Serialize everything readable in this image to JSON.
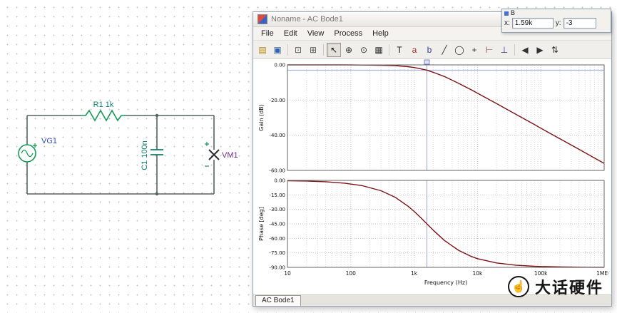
{
  "window": {
    "title": "Noname - AC Bode1",
    "menu": [
      "File",
      "Edit",
      "View",
      "Process",
      "Help"
    ],
    "tab": "AC Bode1",
    "toolbar": [
      {
        "name": "open-file",
        "glyph": "▤",
        "color": "#b8860b"
      },
      {
        "name": "save-file",
        "glyph": "▣",
        "color": "#2f5fae"
      },
      {
        "sep": true
      },
      {
        "name": "copy",
        "glyph": "⊡",
        "color": "#555555"
      },
      {
        "name": "paste",
        "glyph": "⊞",
        "color": "#555555"
      },
      {
        "sep": true
      },
      {
        "name": "select-cursor",
        "glyph": "↖",
        "color": "#111111",
        "pressed": true
      },
      {
        "name": "zoom-in",
        "glyph": "⊕",
        "color": "#333333"
      },
      {
        "name": "zoom-window",
        "glyph": "⊙",
        "color": "#333333"
      },
      {
        "name": "grid-toggle",
        "glyph": "▦",
        "color": "#333333"
      },
      {
        "sep": true
      },
      {
        "name": "text-tool",
        "glyph": "T",
        "color": "#111111"
      },
      {
        "name": "cursor-a-tool",
        "glyph": "a",
        "color": "#a03030"
      },
      {
        "name": "cursor-b-tool",
        "glyph": "b",
        "color": "#3040a0"
      },
      {
        "name": "line-tool",
        "glyph": "╱",
        "color": "#333333"
      },
      {
        "name": "ellipse-tool",
        "glyph": "◯",
        "color": "#333333"
      },
      {
        "name": "cross-tool",
        "glyph": "+",
        "color": "#333333"
      },
      {
        "name": "axis-x-tool",
        "glyph": "⊢",
        "color": "#883333"
      },
      {
        "name": "axis-y-tool",
        "glyph": "⊥",
        "color": "#333388"
      },
      {
        "sep": true
      },
      {
        "name": "prev-curve",
        "glyph": "◀",
        "color": "#333333"
      },
      {
        "name": "next-curve",
        "glyph": "▶",
        "color": "#333333"
      },
      {
        "name": "spin-control",
        "glyph": "⇅",
        "color": "#333333"
      }
    ]
  },
  "cursor_panel": {
    "title": "B",
    "x_label": "x:",
    "x_value": "1.59k",
    "y_label": "y:",
    "y_value": "-3"
  },
  "schematic": {
    "labels": {
      "source": "VG1",
      "resistor": "R1 1k",
      "capacitor": "C1 100n",
      "meter": "VM1"
    },
    "colors": {
      "wire": "#52655c",
      "component": "#149a55",
      "capacitor": "#0f7d6c",
      "value_label": "#0c7f6f",
      "source_label": "#2f49b0",
      "meter_label": "#6a2a8a"
    }
  },
  "watermark": {
    "icon_glyph": "☝",
    "text": "大话硬件"
  },
  "chart_data": [
    {
      "name": "gain-bode-plot",
      "type": "line",
      "title": "",
      "xlabel": "Frequency (Hz)",
      "ylabel": "Gain (dB)",
      "xscale": "log",
      "xlim": [
        10,
        1000000
      ],
      "ylim": [
        -60,
        0
      ],
      "yticks": [
        0,
        -20,
        -40,
        -60
      ],
      "ytick_labels": [
        "0.00",
        "-20.00",
        "-40.00",
        "-60.00"
      ],
      "xticks": [
        10,
        100,
        1000,
        10000,
        100000,
        1000000
      ],
      "xtick_labels": [
        "10",
        "100",
        "1k",
        "10k",
        "100k",
        "1MEG"
      ],
      "show_x_labels": false,
      "grid": true,
      "cursor": {
        "x": 1590,
        "y": -3,
        "label": "B",
        "color": "#96a3dd"
      },
      "series": [
        {
          "name": "gain",
          "color": "#7d1316",
          "x": [
            10,
            20,
            40,
            80,
            150,
            300,
            500,
            800,
            1000,
            1300,
            1590,
            2000,
            3000,
            5000,
            8000,
            10000,
            20000,
            40000,
            80000,
            100000,
            200000,
            400000,
            700000,
            1000000
          ],
          "y": [
            0,
            0,
            0,
            0,
            -0.1,
            -0.2,
            -0.4,
            -1.0,
            -1.5,
            -2.3,
            -3.0,
            -4.2,
            -6.6,
            -10.4,
            -14.2,
            -16.1,
            -22.0,
            -28.0,
            -34.0,
            -36.0,
            -42.0,
            -48.0,
            -52.9,
            -56.0
          ]
        }
      ]
    },
    {
      "name": "phase-bode-plot",
      "type": "line",
      "title": "",
      "xlabel": "Frequency (Hz)",
      "ylabel": "Phase [deg]",
      "xscale": "log",
      "xlim": [
        10,
        1000000
      ],
      "ylim": [
        -90,
        0
      ],
      "yticks": [
        0,
        -15,
        -30,
        -45,
        -60,
        -75,
        -90
      ],
      "ytick_labels": [
        "0.00",
        "-15.00",
        "-30.00",
        "-45.00",
        "-60.00",
        "-75.00",
        "-90.00"
      ],
      "xticks": [
        10,
        100,
        1000,
        10000,
        100000,
        1000000
      ],
      "xtick_labels": [
        "10",
        "100",
        "1k",
        "10k",
        "100k",
        "1MEG"
      ],
      "show_x_labels": true,
      "grid": true,
      "cursor": {
        "x": 1590,
        "color": "#96a3dd"
      },
      "series": [
        {
          "name": "phase",
          "color": "#7d1316",
          "x": [
            10,
            20,
            40,
            80,
            150,
            300,
            500,
            800,
            1000,
            1300,
            1590,
            2000,
            3000,
            5000,
            8000,
            10000,
            20000,
            40000,
            80000,
            100000,
            200000,
            400000,
            700000,
            1000000
          ],
          "y": [
            -0.4,
            -0.7,
            -1.4,
            -2.9,
            -5.4,
            -10.7,
            -17.4,
            -26.7,
            -32.1,
            -39.2,
            -45.0,
            -51.5,
            -62.1,
            -72.3,
            -78.7,
            -81.0,
            -85.4,
            -87.7,
            -88.9,
            -89.1,
            -89.5,
            -89.8,
            -89.9,
            -89.9
          ]
        }
      ]
    }
  ]
}
